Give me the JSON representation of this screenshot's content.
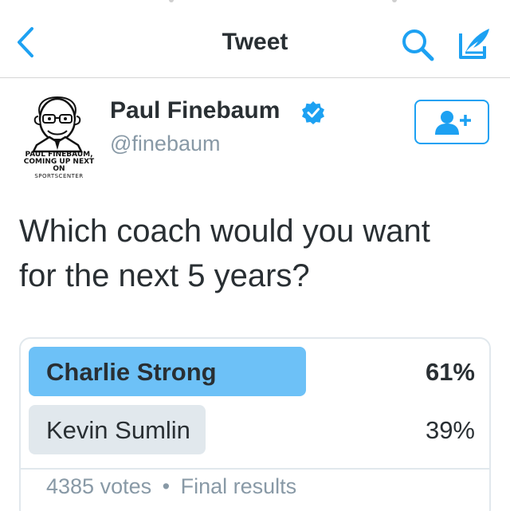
{
  "navbar": {
    "title": "Tweet",
    "back_icon": "chevron-left-icon",
    "search_icon": "search-icon",
    "compose_icon": "compose-icon"
  },
  "tweet": {
    "author": {
      "display_name": "Paul Finebaum",
      "handle": "@finebaum",
      "verified": true,
      "avatar_caption_line1": "PAUL FINEBAUM,",
      "avatar_caption_line2": "COMING UP NEXT ON",
      "avatar_caption_line3": "SPORTSCENTER"
    },
    "text_line1": "Which coach would you want",
    "text_line2": "for the next 5 years?"
  },
  "follow_button": {
    "icon": "add-user-icon"
  },
  "poll": {
    "options": [
      {
        "label": "Charlie Strong",
        "percent": "61%",
        "fraction": 0.61,
        "winner": true
      },
      {
        "label": "Kevin Sumlin",
        "percent": "39%",
        "fraction": 0.39,
        "winner": false
      }
    ],
    "votes": "4385 votes",
    "separator": "•",
    "status": "Final results"
  },
  "colors": {
    "accent": "#1da1f2",
    "winner_bar": "#6dc1f7",
    "loser_bar": "#e1e8ed",
    "muted_text": "#8899a6",
    "text": "#292f33"
  }
}
